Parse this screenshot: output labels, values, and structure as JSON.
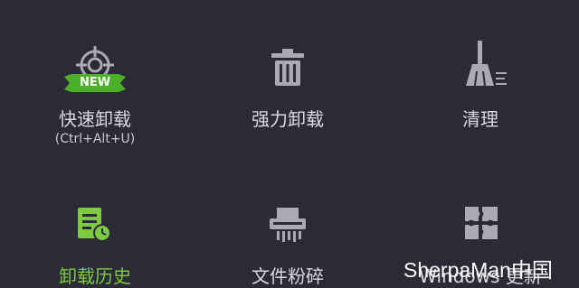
{
  "tools": {
    "fast_uninstall": {
      "label": "快速卸载",
      "shortcut": "(Ctrl+Alt+U)",
      "badge": "NEW",
      "icon": "target-crosshair-icon"
    },
    "force_uninstall": {
      "label": "强力卸载",
      "icon": "trash-bin-icon"
    },
    "cleanup": {
      "label": "清理",
      "icon": "broom-icon"
    },
    "uninstall_history": {
      "label": "卸载历史",
      "icon": "history-document-icon"
    },
    "file_shredder": {
      "label": "文件粉碎",
      "icon": "shredder-icon"
    },
    "windows_update": {
      "label": "Windows 更新",
      "icon": "puzzle-icon"
    }
  },
  "colors": {
    "background": "#2a2b36",
    "icon": "#a9aab3",
    "accent_green": "#7dc93f",
    "badge_green": "#4caf2a",
    "text": "#d9dae0"
  },
  "watermark": "SherpaMan中国"
}
